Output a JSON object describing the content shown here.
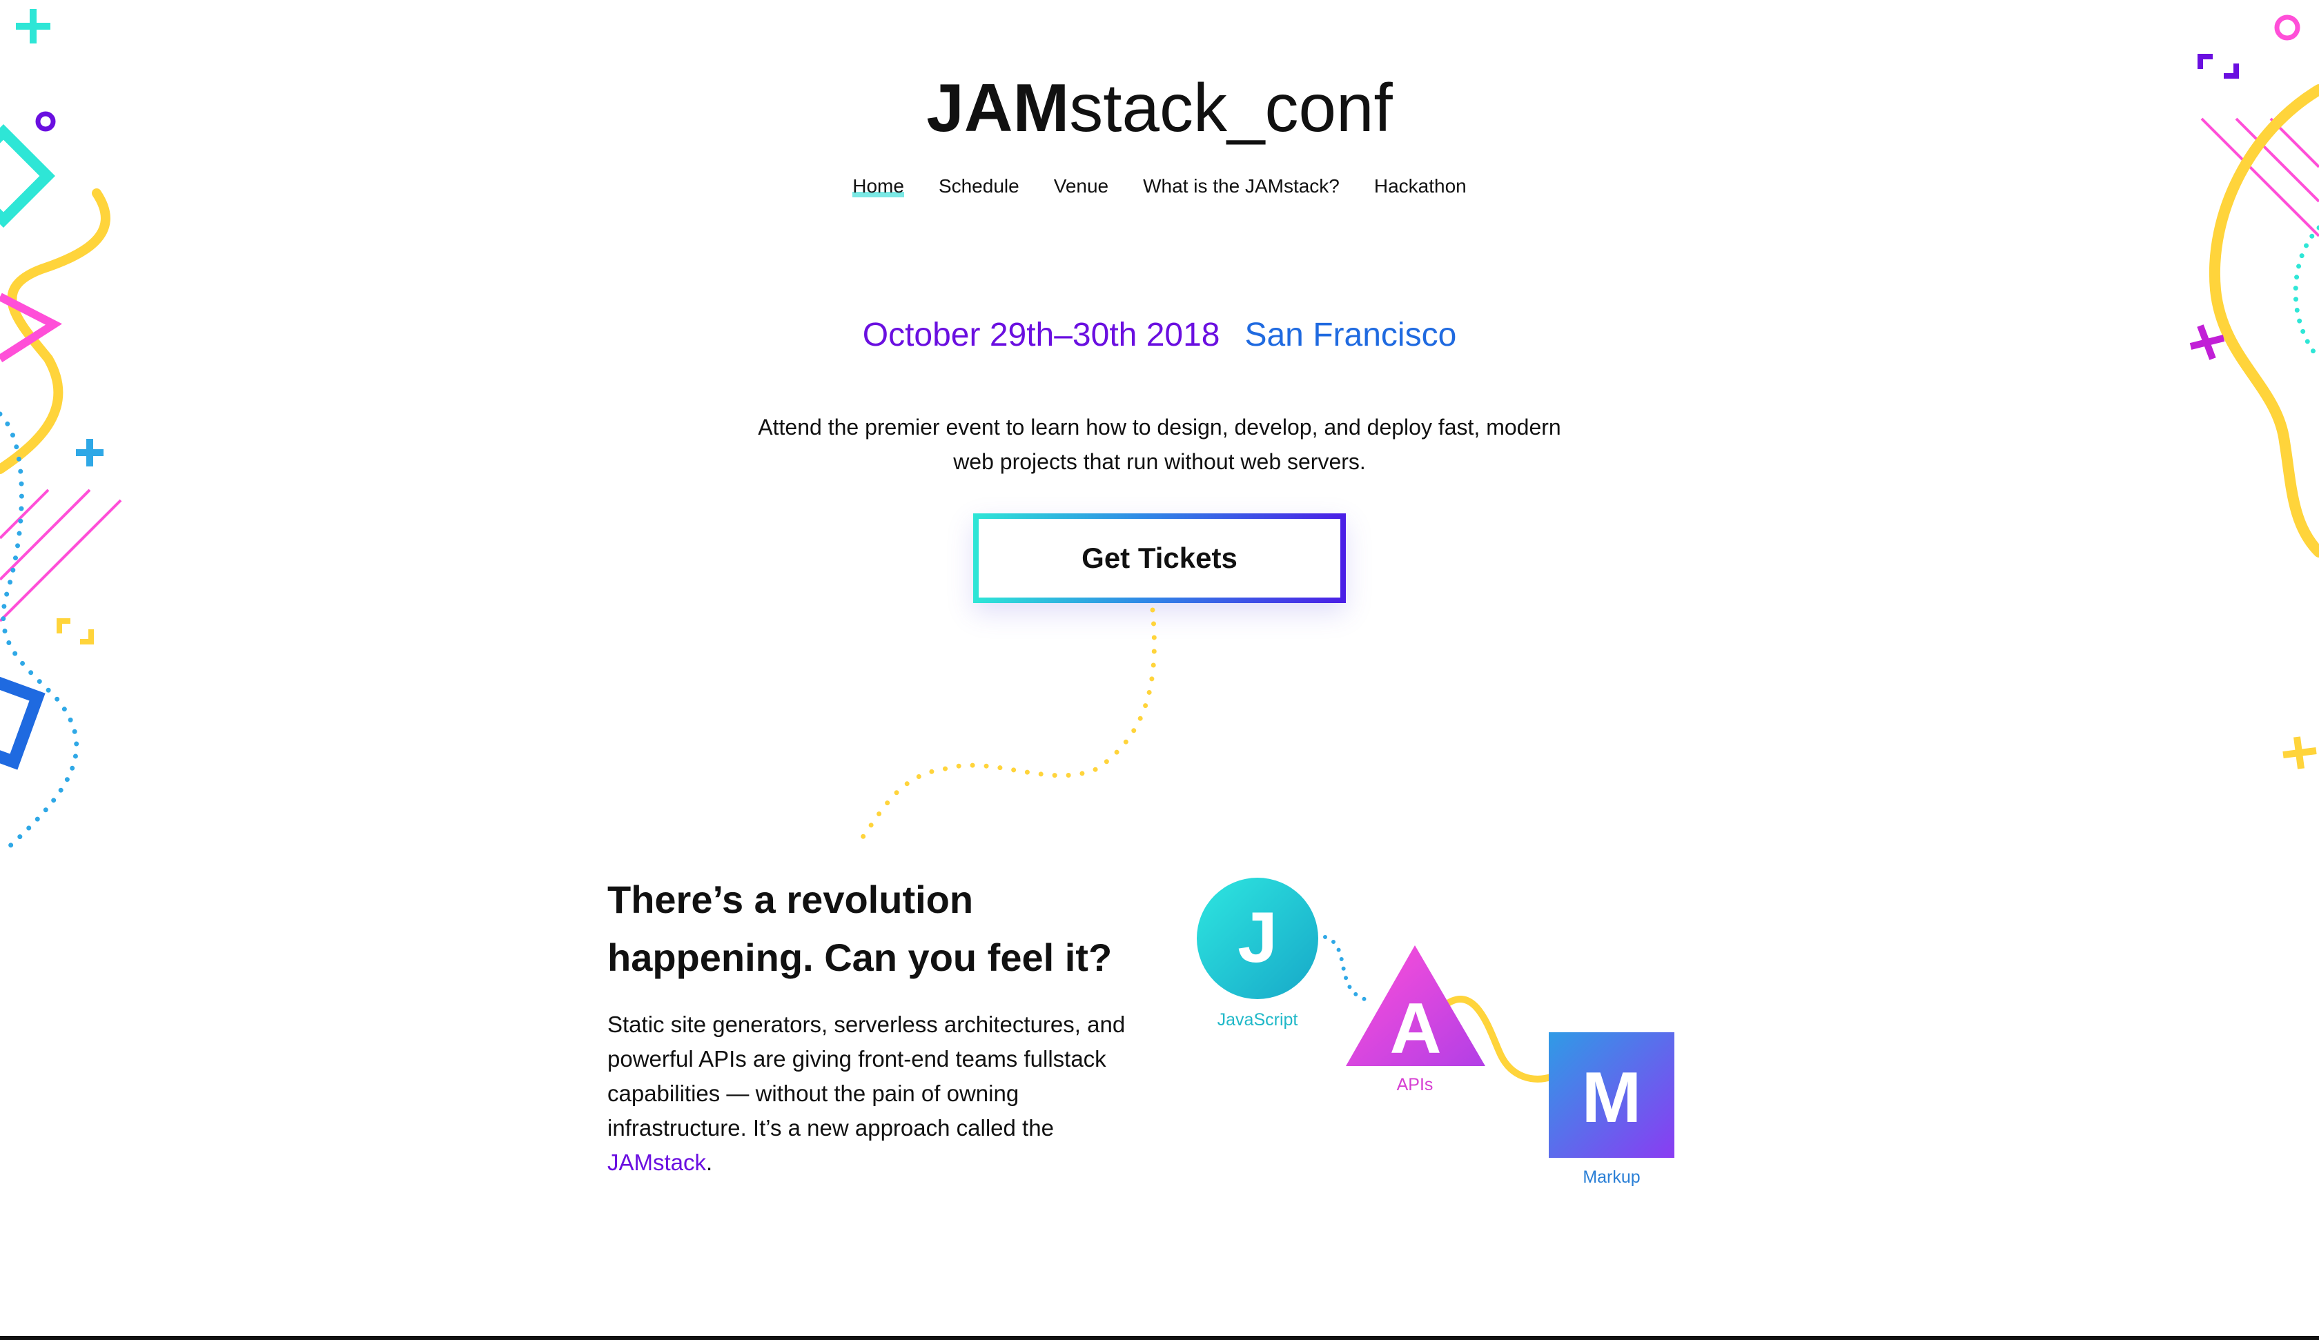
{
  "header": {
    "title_bold": "JAM",
    "title_light": "stack_conf"
  },
  "nav": {
    "items": [
      {
        "label": "Home",
        "active": true
      },
      {
        "label": "Schedule",
        "active": false
      },
      {
        "label": "Venue",
        "active": false
      },
      {
        "label": "What is the JAMstack?",
        "active": false
      },
      {
        "label": "Hackathon",
        "active": false
      }
    ]
  },
  "event": {
    "date": "October 29th–30th 2018",
    "city": "San Francisco",
    "description": "Attend the premier event to learn how to design, develop, and deploy fast, modern web projects that run without web servers."
  },
  "cta": {
    "label": "Get Tickets"
  },
  "revolution": {
    "heading_line1": "There’s a revolution",
    "heading_line2": "happening. Can you feel it?",
    "body_before_link": "Static site generators, serverless architectures, and powerful APIs are giving front-end teams fullstack capabilities — without the pain of owning infrastructure. It’s a new approach called the ",
    "link_text": "JAMstack",
    "body_after_link": "."
  },
  "jam_diagram": {
    "javascript": {
      "letter": "J",
      "label": "JavaScript",
      "color": "#1fb8c8"
    },
    "apis": {
      "letter": "A",
      "label": "APIs",
      "color": "#d63fd2"
    },
    "markup": {
      "letter": "M",
      "label": "Markup",
      "color": "#2a7fd6"
    }
  },
  "colors": {
    "purple": "#6a0fe0",
    "blue": "#1f6ae0",
    "teal": "#2ee6d6",
    "yellow": "#ffd43b",
    "pink": "#ff4fd8"
  }
}
